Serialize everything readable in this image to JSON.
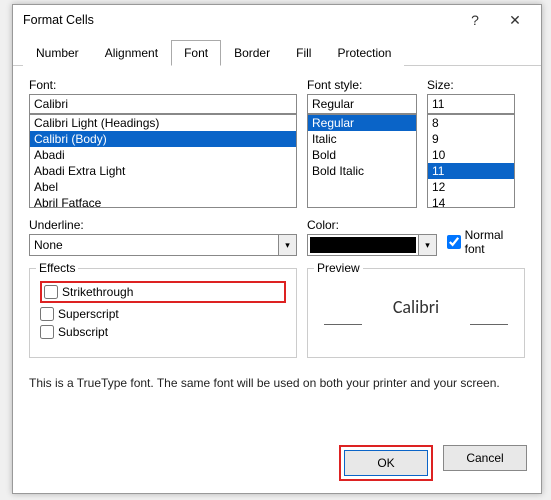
{
  "title": "Format Cells",
  "tabs": [
    "Number",
    "Alignment",
    "Font",
    "Border",
    "Fill",
    "Protection"
  ],
  "activeTab": 2,
  "font": {
    "label": "Font:",
    "value": "Calibri",
    "items": [
      "Calibri Light (Headings)",
      "Calibri (Body)",
      "Abadi",
      "Abadi Extra Light",
      "Abel",
      "Abril Fatface"
    ],
    "selectedIndex": 1
  },
  "style": {
    "label": "Font style:",
    "value": "Regular",
    "items": [
      "Regular",
      "Italic",
      "Bold",
      "Bold Italic"
    ],
    "selectedIndex": 0
  },
  "size": {
    "label": "Size:",
    "value": "11",
    "items": [
      "8",
      "9",
      "10",
      "11",
      "12",
      "14"
    ],
    "selectedIndex": 3
  },
  "underline": {
    "label": "Underline:",
    "value": "None"
  },
  "color": {
    "label": "Color:",
    "value": "#000000"
  },
  "normalFont": {
    "label": "Normal font",
    "checked": true
  },
  "effects": {
    "legend": "Effects",
    "strike": "Strikethrough",
    "superscript": "Superscript",
    "subscript": "Subscript"
  },
  "preview": {
    "legend": "Preview",
    "sample": "Calibri"
  },
  "description": "This is a TrueType font.  The same font will be used on both your printer and your screen.",
  "buttons": {
    "ok": "OK",
    "cancel": "Cancel"
  }
}
